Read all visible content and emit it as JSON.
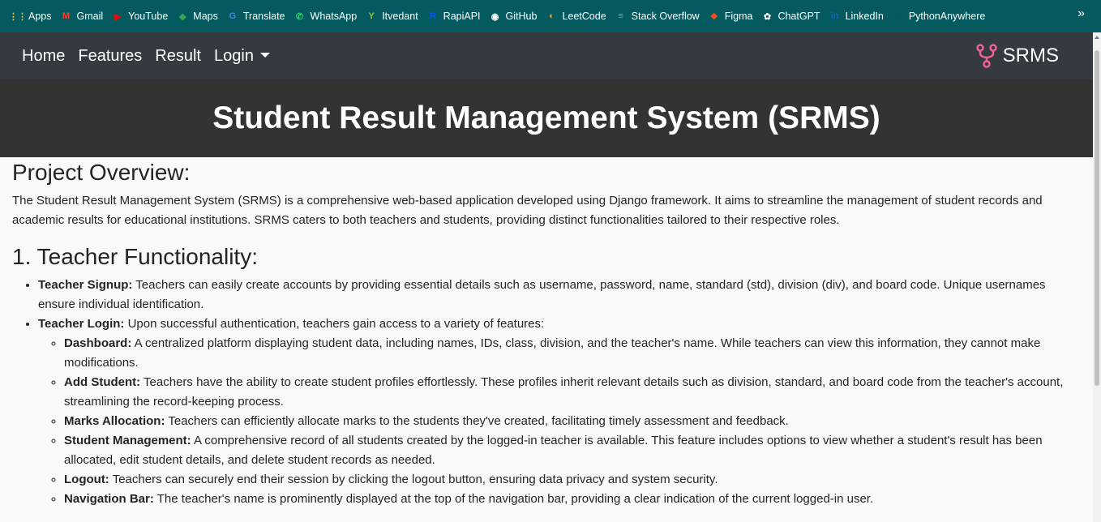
{
  "bookmarks": [
    {
      "label": "Apps",
      "icon": "apps-grid-icon",
      "glyph": "⋮⋮",
      "color": "#e8c23a"
    },
    {
      "label": "Gmail",
      "icon": "gmail-icon",
      "glyph": "M",
      "color": "#ea4335"
    },
    {
      "label": "YouTube",
      "icon": "youtube-icon",
      "glyph": "▶",
      "color": "#ff0000"
    },
    {
      "label": "Maps",
      "icon": "maps-icon",
      "glyph": "◆",
      "color": "#34a853"
    },
    {
      "label": "Translate",
      "icon": "translate-icon",
      "glyph": "G",
      "color": "#4285f4"
    },
    {
      "label": "WhatsApp",
      "icon": "whatsapp-icon",
      "glyph": "✆",
      "color": "#25d366"
    },
    {
      "label": "Itvedant",
      "icon": "itvedant-icon",
      "glyph": "Y",
      "color": "#8bc34a"
    },
    {
      "label": "RapiAPI",
      "icon": "rapidapi-icon",
      "glyph": "R",
      "color": "#0055ff"
    },
    {
      "label": "GitHub",
      "icon": "github-icon",
      "glyph": "◉",
      "color": "#ffffff"
    },
    {
      "label": "LeetCode",
      "icon": "leetcode-icon",
      "glyph": "◐",
      "color": "#ffa116"
    },
    {
      "label": "Stack Overflow",
      "icon": "stackoverflow-icon",
      "glyph": "≡",
      "color": "#f48024"
    },
    {
      "label": "Figma",
      "icon": "figma-icon",
      "glyph": "❖",
      "color": "#f24e1e"
    },
    {
      "label": "ChatGPT",
      "icon": "chatgpt-icon",
      "glyph": "✿",
      "color": "#ffffff"
    },
    {
      "label": "LinkedIn",
      "icon": "linkedin-icon",
      "glyph": "in",
      "color": "#0a66c2"
    },
    {
      "label": "PythonAnywhere",
      "icon": "pythonanywhere-icon",
      "glyph": "◌",
      "color": "#1f4f4f"
    }
  ],
  "bookmarks_more": "»",
  "nav": {
    "home": "Home",
    "features": "Features",
    "result": "Result",
    "login": "Login",
    "brand": "SRMS",
    "brand_color": "#f06292"
  },
  "hero": {
    "title": "Student Result Management System (SRMS)"
  },
  "content": {
    "overview_heading": "Project Overview:",
    "overview_text": "The Student Result Management System (SRMS) is a comprehensive web-based application developed using Django framework. It aims to streamline the management of student records and academic results for educational institutions. SRMS caters to both teachers and students, providing distinct functionalities tailored to their respective roles.",
    "teacher_heading": "1. Teacher Functionality:",
    "signup_label": "Teacher Signup:",
    "signup_text": " Teachers can easily create accounts by providing essential details such as username, password, name, standard (std), division (div), and board code. Unique usernames ensure individual identification.",
    "login_label": "Teacher Login:",
    "login_text": " Upon successful authentication, teachers gain access to a variety of features:",
    "features": [
      {
        "label": "Dashboard:",
        "text": " A centralized platform displaying student data, including names, IDs, class, division, and the teacher's name. While teachers can view this information, they cannot make modifications."
      },
      {
        "label": "Add Student:",
        "text": " Teachers have the ability to create student profiles effortlessly. These profiles inherit relevant details such as division, standard, and board code from the teacher's account, streamlining the record-keeping process."
      },
      {
        "label": "Marks Allocation:",
        "text": " Teachers can efficiently allocate marks to the students they've created, facilitating timely assessment and feedback."
      },
      {
        "label": "Student Management:",
        "text": " A comprehensive record of all students created by the logged-in teacher is available. This feature includes options to view whether a student's result has been allocated, edit student details, and delete student records as needed."
      },
      {
        "label": "Logout:",
        "text": " Teachers can securely end their session by clicking the logout button, ensuring data privacy and system security."
      },
      {
        "label": "Navigation Bar:",
        "text": " The teacher's name is prominently displayed at the top of the navigation bar, providing a clear indication of the current logged-in user."
      }
    ]
  }
}
